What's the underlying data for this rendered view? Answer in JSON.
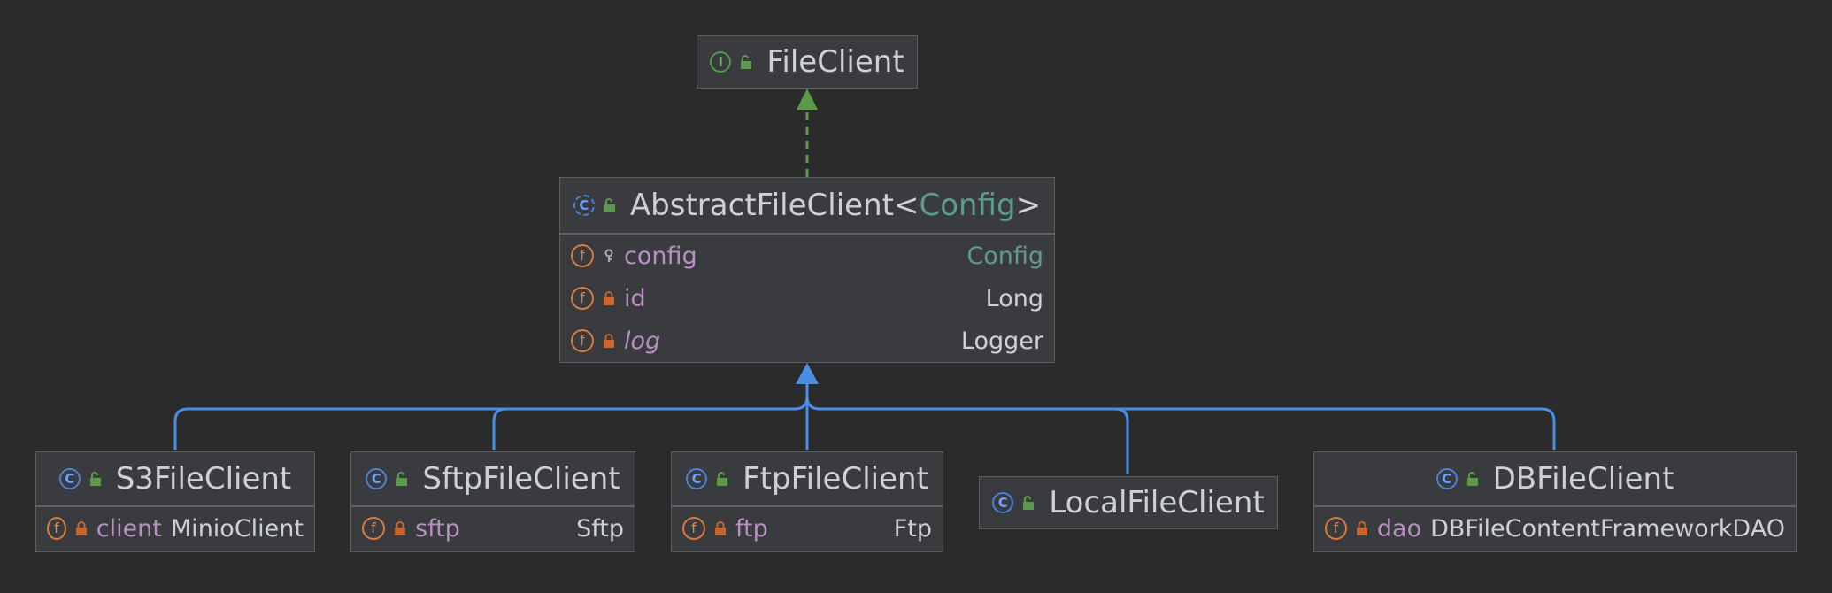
{
  "colors": {
    "background": "#2b2b2b",
    "node_fill": "#393b3e",
    "node_border": "#5b5e63",
    "text": "#cdd0d4",
    "field_name": "#b78fc0",
    "generic_type": "#5f9a8a",
    "implements_edge": "#5a9a4a",
    "extends_edge": "#4a8ee6",
    "interface_icon": "#5fb05f",
    "class_icon": "#6aa0ff",
    "field_icon": "#e08a4e"
  },
  "interface_node": {
    "name": "FileClient",
    "kind_icon": "interface-icon",
    "kind_letter": "I",
    "visibility_icon": "public-unlock-icon"
  },
  "abstract_node": {
    "name": "AbstractFileClient",
    "open": "<",
    "generic_param": "Config",
    "close": ">",
    "kind_icon": "abstract-class-icon",
    "kind_letter": "C",
    "visibility_icon": "public-unlock-icon",
    "fields": [
      {
        "name": "config",
        "type": "Config",
        "visibility_icon": "protected-key-icon",
        "type_is_generic": true,
        "italic": false
      },
      {
        "name": "id",
        "type": "Long",
        "visibility_icon": "private-lock-icon",
        "type_is_generic": false,
        "italic": false
      },
      {
        "name": "log",
        "type": "Logger",
        "visibility_icon": "private-lock-icon",
        "type_is_generic": false,
        "italic": true
      }
    ]
  },
  "subclasses": [
    {
      "name": "S3FileClient",
      "kind_letter": "C",
      "field": {
        "name": "client",
        "type": "MinioClient"
      }
    },
    {
      "name": "SftpFileClient",
      "kind_letter": "C",
      "field": {
        "name": "sftp",
        "type": "Sftp"
      }
    },
    {
      "name": "FtpFileClient",
      "kind_letter": "C",
      "field": {
        "name": "ftp",
        "type": "Ftp"
      }
    },
    {
      "name": "LocalFileClient",
      "kind_letter": "C",
      "field": null
    },
    {
      "name": "DBFileClient",
      "kind_letter": "C",
      "field": {
        "name": "dao",
        "type": "DBFileContentFrameworkDAO"
      }
    }
  ],
  "field_letter": "f",
  "relations": [
    {
      "from": "AbstractFileClient",
      "to": "FileClient",
      "kind": "implements"
    },
    {
      "from": "S3FileClient",
      "to": "AbstractFileClient",
      "kind": "extends"
    },
    {
      "from": "SftpFileClient",
      "to": "AbstractFileClient",
      "kind": "extends"
    },
    {
      "from": "FtpFileClient",
      "to": "AbstractFileClient",
      "kind": "extends"
    },
    {
      "from": "LocalFileClient",
      "to": "AbstractFileClient",
      "kind": "extends"
    },
    {
      "from": "DBFileClient",
      "to": "AbstractFileClient",
      "kind": "extends"
    }
  ]
}
